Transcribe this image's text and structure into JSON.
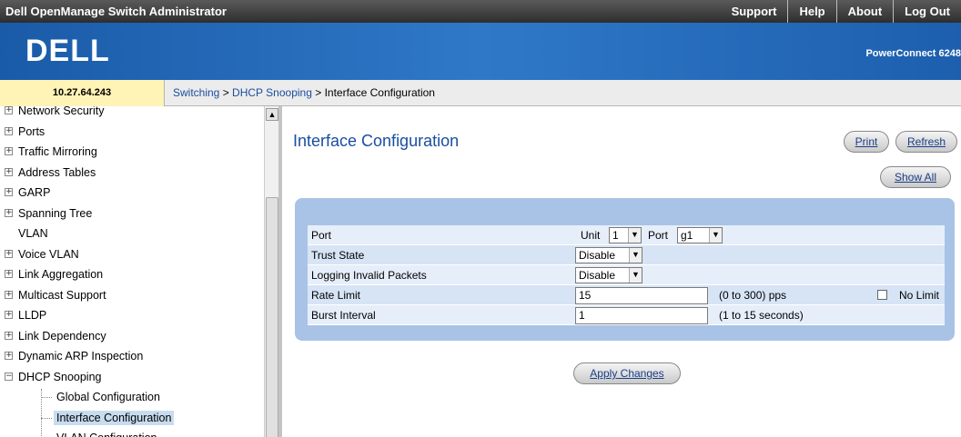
{
  "topbar": {
    "title": "Dell OpenManage Switch Administrator",
    "links": [
      "Support",
      "Help",
      "About",
      "Log Out"
    ]
  },
  "banner": {
    "logo": "DΕLL",
    "product": "PowerConnect 6248"
  },
  "ip_address": "10.27.64.243",
  "breadcrumb": {
    "parts": [
      "Switching",
      "DHCP Snooping",
      "Interface Configuration"
    ],
    "separator": " > "
  },
  "sidebar": {
    "items": [
      {
        "label": "Network Security",
        "expandable": true
      },
      {
        "label": "Ports",
        "expandable": true
      },
      {
        "label": "Traffic Mirroring",
        "expandable": true
      },
      {
        "label": "Address Tables",
        "expandable": true
      },
      {
        "label": "GARP",
        "expandable": true
      },
      {
        "label": "Spanning Tree",
        "expandable": true
      },
      {
        "label": "VLAN",
        "expandable": false
      },
      {
        "label": "Voice VLAN",
        "expandable": true
      },
      {
        "label": "Link Aggregation",
        "expandable": true
      },
      {
        "label": "Multicast Support",
        "expandable": true
      },
      {
        "label": "LLDP",
        "expandable": true
      },
      {
        "label": "Link Dependency",
        "expandable": true
      },
      {
        "label": "Dynamic ARP Inspection",
        "expandable": true
      },
      {
        "label": "DHCP Snooping",
        "expandable": true,
        "expanded": true
      }
    ],
    "subitems": [
      {
        "label": "Global Configuration"
      },
      {
        "label": "Interface Configuration",
        "selected": true
      },
      {
        "label": "VLAN Configuration"
      }
    ]
  },
  "main": {
    "title": "Interface Configuration",
    "print_label": "Print",
    "refresh_label": "Refresh",
    "show_all_label": "Show All",
    "apply_label": "Apply Changes"
  },
  "config": {
    "port_label": "Port",
    "unit_label": "Unit",
    "unit_value": "1",
    "port_field_label": "Port",
    "port_value": "g1",
    "trust_state_label": "Trust State",
    "trust_state_value": "Disable",
    "logging_label": "Logging Invalid Packets",
    "logging_value": "Disable",
    "rate_limit_label": "Rate Limit",
    "rate_limit_value": "15",
    "rate_limit_range": "(0 to 300) pps",
    "no_limit_label": "No Limit",
    "no_limit_checked": false,
    "burst_label": "Burst Interval",
    "burst_value": "1",
    "burst_range": "(1 to 15 seconds)"
  }
}
